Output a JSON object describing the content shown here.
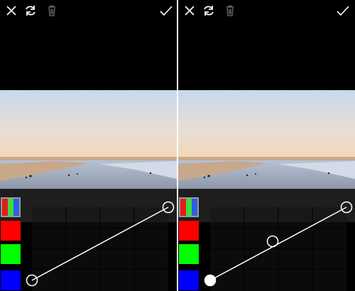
{
  "toolbar": {
    "icons": [
      "close-icon",
      "rotate-icon",
      "trash-icon",
      "checkmark-icon"
    ]
  },
  "channels": [
    {
      "name": "rgb",
      "icon": "rgb-channel-icon",
      "colors": [
        "#e21b1b",
        "#3ddc3d",
        "#2b5fe8"
      ]
    },
    {
      "name": "red",
      "color": "#ff0000"
    },
    {
      "name": "green",
      "color": "#00ff00"
    },
    {
      "name": "blue",
      "color": "#0000ff"
    }
  ],
  "panels": [
    {
      "id": "left",
      "curve_points_count": 2,
      "active_point": "top-right"
    },
    {
      "id": "right",
      "curve_points_count": 3,
      "active_point": "bottom-left"
    }
  ],
  "colors": {
    "background": "#000000",
    "sky_top": "#c9daec",
    "sky_horizon": "#f2d8b8",
    "sand": "#c9a78a"
  }
}
